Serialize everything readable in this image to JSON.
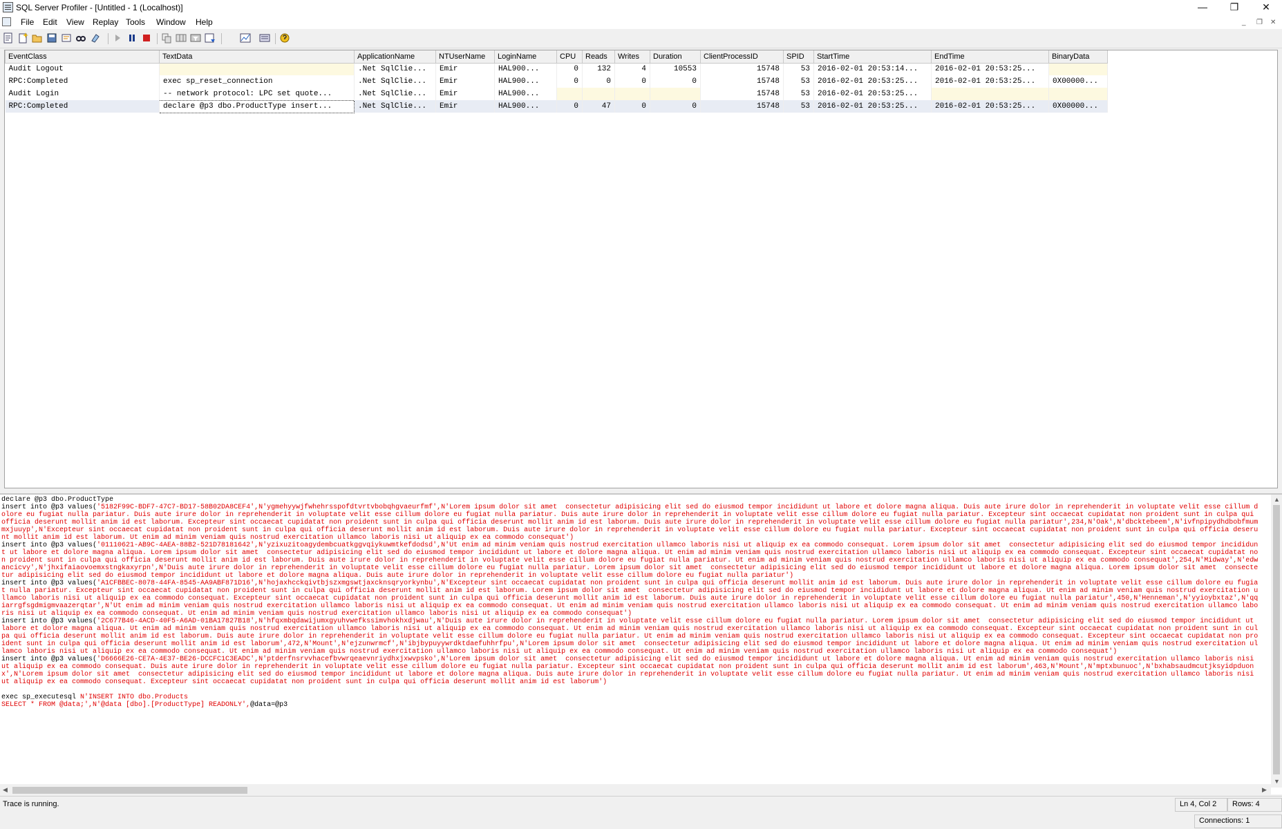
{
  "window": {
    "title": "SQL Server Profiler - [Untitled - 1 (Localhost)]",
    "minimize": "—",
    "restore": "❐",
    "close": "✕"
  },
  "menu": [
    "File",
    "Edit",
    "View",
    "Replay",
    "Tools",
    "Window",
    "Help"
  ],
  "mdi": {
    "minimize": "_",
    "restore": "❐",
    "close": "✕"
  },
  "toolbar": [
    "new-trace-icon",
    "new-template-icon",
    "open-icon",
    "save-icon",
    "properties-icon",
    "find-icon",
    "clear-icon",
    "run-icon",
    "pause-icon",
    "stop-icon",
    "template-icon",
    "columns-icon",
    "filter-icon",
    "scroll-icon",
    "perfmon-icon",
    "options-icon",
    "help-icon"
  ],
  "grid": {
    "columns": [
      "EventClass",
      "TextData",
      "ApplicationName",
      "NTUserName",
      "LoginName",
      "CPU",
      "Reads",
      "Writes",
      "Duration",
      "ClientProcessID",
      "SPID",
      "StartTime",
      "EndTime",
      "BinaryData"
    ],
    "rows": [
      [
        "Audit Logout",
        "",
        ".Net SqlClie...",
        "Emir",
        "HAL900...",
        "0",
        "132",
        "4",
        "10553",
        "15748",
        "53",
        "2016-02-01 20:53:14...",
        "2016-02-01 20:53:25...",
        ""
      ],
      [
        "RPC:Completed",
        "exec sp_reset_connection",
        ".Net SqlClie...",
        "Emir",
        "HAL900...",
        "0",
        "0",
        "0",
        "0",
        "15748",
        "53",
        "2016-02-01 20:53:25...",
        "2016-02-01 20:53:25...",
        "0X00000..."
      ],
      [
        "Audit Login",
        "-- network protocol: LPC  set quote...",
        ".Net SqlClie...",
        "Emir",
        "HAL900...",
        "",
        "",
        "",
        "",
        "15748",
        "53",
        "2016-02-01 20:53:25...",
        "",
        ""
      ],
      [
        "RPC:Completed",
        "declare @p3 dbo.ProductType  insert...",
        ".Net SqlClie...",
        "Emir",
        "HAL900...",
        "0",
        "47",
        "0",
        "0",
        "15748",
        "53",
        "2016-02-01 20:53:25...",
        "2016-02-01 20:53:25...",
        "0X00000..."
      ]
    ]
  },
  "detail": {
    "line1": "declare @p3 dbo.ProductType",
    "inserts": [
      {
        "prefix": "insert into @p3 values(",
        "body": "'5182F99C-BDF7-47C7-BD17-58B02DA8CEF4',N'ygmehyywjfwhehrsspofdtvrtvbobqhgvaeurfmf',N'Lorem ipsum dolor sit amet  consectetur adipisicing elit sed do eiusmod tempor incididunt ut labore et dolore magna aliqua. Duis aute irure dolor in reprehenderit in voluptate velit esse cillum dolore eu fugiat nulla pariatur. Duis aute irure dolor in reprehenderit in voluptate velit esse cillum dolore eu fugiat nulla pariatur. Duis aute irure dolor in reprehenderit in voluptate velit esse cillum dolore eu fugiat nulla pariatur. Excepteur sint occaecat cupidatat non proident sunt in culpa qui officia deserunt mollit anim id est laborum. Excepteur sint occaecat cupidatat non proident sunt in culpa qui officia deserunt mollit anim id est laborum. Duis aute irure dolor in reprehenderit in voluptate velit esse cillum dolore eu fugiat nulla pariatur',234,N'Oak',N'dbcktebeem',N'ivfnpipydhdbobfmummxjuuyp',N'Excepteur sint occaecat cupidatat non proident sunt in culpa qui officia deserunt mollit anim id est laborum. Duis aute irure dolor in reprehenderit in voluptate velit esse cillum dolore eu fugiat nulla pariatur. Excepteur sint occaecat cupidatat non proident sunt in culpa qui officia deserunt mollit anim id est laborum. Ut enim ad minim veniam quis nostrud exercitation ullamco laboris nisi ut aliquip ex ea commodo consequat')"
      },
      {
        "prefix": "insert into @p3 values(",
        "body": "'01110621-AB9C-4AEA-88B2-521D78181642',N'yzixuzitoagydembcuatkggvqiykuwmtkefdodsd',N'Ut enim ad minim veniam quis nostrud exercitation ullamco laboris nisi ut aliquip ex ea commodo consequat. Lorem ipsum dolor sit amet  consectetur adipisicing elit sed do eiusmod tempor incididunt ut labore et dolore magna aliqua. Lorem ipsum dolor sit amet  consectetur adipisicing elit sed do eiusmod tempor incididunt ut labore et dolore magna aliqua. Ut enim ad minim veniam quis nostrud exercitation ullamco laboris nisi ut aliquip ex ea commodo consequat. Excepteur sint occaecat cupidatat non proident sunt in culpa qui officia deserunt mollit anim id est laborum. Duis aute irure dolor in reprehenderit in voluptate velit esse cillum dolore eu fugiat nulla pariatur. Ut enim ad minim veniam quis nostrud exercitation ullamco laboris nisi ut aliquip ex ea commodo consequat',254,N'Midway',N'edwancicvy',N'jhxifaiaovoemxstngkaxyrpn',N'Duis aute irure dolor in reprehenderit in voluptate velit esse cillum dolore eu fugiat nulla pariatur. Lorem ipsum dolor sit amet  consectetur adipisicing elit sed do eiusmod tempor incididunt ut labore et dolore magna aliqua. Lorem ipsum dolor sit amet  consectetur adipisicing elit sed do eiusmod tempor incididunt ut labore et dolore magna aliqua. Duis aute irure dolor in reprehenderit in voluptate velit esse cillum dolore eu fugiat nulla pariatur')"
      },
      {
        "prefix": "insert into @p3 values(",
        "body": "'A1CFBBEC-8078-44FA-8545-AA9ABF871D16',N'hojaxhcckqivtbjszxmgswtjaxcknsqryorkynbu',N'Excepteur sint occaecat cupidatat non proident sunt in culpa qui officia deserunt mollit anim id est laborum. Duis aute irure dolor in reprehenderit in voluptate velit esse cillum dolore eu fugiat nulla pariatur. Excepteur sint occaecat cupidatat non proident sunt in culpa qui officia deserunt mollit anim id est laborum. Lorem ipsum dolor sit amet  consectetur adipisicing elit sed do eiusmod tempor incididunt ut labore et dolore magna aliqua. Ut enim ad minim veniam quis nostrud exercitation ullamco laboris nisi ut aliquip ex ea commodo consequat. Excepteur sint occaecat cupidatat non proident sunt in culpa qui officia deserunt mollit anim id est laborum. Duis aute irure dolor in reprehenderit in voluptate velit esse cillum dolore eu fugiat nulla pariatur',450,N'Henneman',N'yyioybxtaz',N'qqiarrgfsgdmigmvaazerqtar',N'Ut enim ad minim veniam quis nostrud exercitation ullamco laboris nisi ut aliquip ex ea commodo consequat. Ut enim ad minim veniam quis nostrud exercitation ullamco laboris nisi ut aliquip ex ea commodo consequat. Ut enim ad minim veniam quis nostrud exercitation ullamco laboris nisi ut aliquip ex ea commodo consequat. Ut enim ad minim veniam quis nostrud exercitation ullamco laboris nisi ut aliquip ex ea commodo consequat')"
      },
      {
        "prefix": "insert into @p3 values(",
        "body": "'2C677B46-4ACD-40F5-A6AD-01BA17827B18',N'hfqxmbqdawijumxgyuhvwefkssimvhokhxdjwau',N'Duis aute irure dolor in reprehenderit in voluptate velit esse cillum dolore eu fugiat nulla pariatur. Lorem ipsum dolor sit amet  consectetur adipisicing elit sed do eiusmod tempor incididunt ut labore et dolore magna aliqua. Ut enim ad minim veniam quis nostrud exercitation ullamco laboris nisi ut aliquip ex ea commodo consequat. Ut enim ad minim veniam quis nostrud exercitation ullamco laboris nisi ut aliquip ex ea commodo consequat. Excepteur sint occaecat cupidatat non proident sunt in culpa qui officia deserunt mollit anim id est laborum. Duis aute irure dolor in reprehenderit in voluptate velit esse cillum dolore eu fugiat nulla pariatur. Ut enim ad minim veniam quis nostrud exercitation ullamco laboris nisi ut aliquip ex ea commodo consequat. Excepteur sint occaecat cupidatat non proident sunt in culpa qui officia deserunt mollit anim id est laborum',472,N'Mount',N'ejzunwrmcf',N'ibjbypuyywrdktdaefuhhrfpu',N'Lorem ipsum dolor sit amet  consectetur adipisicing elit sed do eiusmod tempor incididunt ut labore et dolore magna aliqua. Ut enim ad minim veniam quis nostrud exercitation ullamco laboris nisi ut aliquip ex ea commodo consequat. Ut enim ad minim veniam quis nostrud exercitation ullamco laboris nisi ut aliquip ex ea commodo consequat. Ut enim ad minim veniam quis nostrud exercitation ullamco laboris nisi ut aliquip ex ea commodo consequat')"
      },
      {
        "prefix": "insert into @p3 values(",
        "body": "'D6666E26-CE7A-4E37-BE26-DCCFC1C3EADC',N'ptderfnsrvvhacefbvwrqeaevnriydhxjxwvpsko',N'Lorem ipsum dolor sit amet  consectetur adipisicing elit sed do eiusmod tempor incididunt ut labore et dolore magna aliqua. Ut enim ad minim veniam quis nostrud exercitation ullamco laboris nisi ut aliquip ex ea commodo consequat. Duis aute irure dolor in reprehenderit in voluptate velit esse cillum dolore eu fugiat nulla pariatur. Excepteur sint occaecat cupidatat non proident sunt in culpa qui officia deserunt mollit anim id est laborum',463,N'Mount',N'mptxbunuoc',N'bxhabsaudmcutjksyidpduonx',N'Lorem ipsum dolor sit amet  consectetur adipisicing elit sed do eiusmod tempor incididunt ut labore et dolore magna aliqua. Duis aute irure dolor in reprehenderit in voluptate velit esse cillum dolore eu fugiat nulla pariatur. Ut enim ad minim veniam quis nostrud exercitation ullamco laboris nisi ut aliquip ex ea commodo consequat. Excepteur sint occaecat cupidatat non proident sunt in culpa qui officia deserunt mollit anim id est laborum')"
      }
    ],
    "exec_prefix": "exec sp_executesql ",
    "exec_body": "N'INSERT INTO dbo.Products",
    "select_line": "SELECT * FROM @data;',N'@data [dbo].[ProductType] READONLY',",
    "select_tail": "@data=@p3"
  },
  "status": {
    "message": "Trace is running.",
    "position": "Ln 4, Col 2",
    "rows": "Rows: 4",
    "connections": "Connections: 1"
  }
}
